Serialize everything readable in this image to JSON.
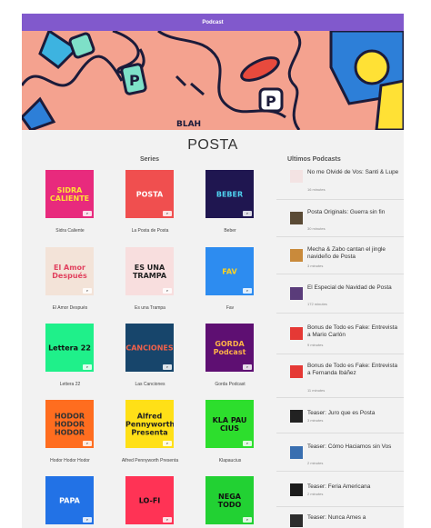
{
  "topbar": {
    "title": "Podcast"
  },
  "hero": {
    "doodle_text": "BLAH"
  },
  "page": {
    "title": "POSTA"
  },
  "sections": {
    "series": "Series",
    "latest": "Ultimos Podcasts"
  },
  "series": [
    {
      "name": "Sidra Caliente",
      "cover_text": "SIDRA CALIENTE",
      "bg": "#e82a7d",
      "fg": "#ffe135"
    },
    {
      "name": "La Posta de Posta",
      "cover_text": "POSTA",
      "bg": "#f04f4f",
      "fg": "#ffffff"
    },
    {
      "name": "Beber",
      "cover_text": "BEBER",
      "bg": "#1f1650",
      "fg": "#4fd3f0"
    },
    {
      "name": "El Amor Después",
      "cover_text": "El Amor Después",
      "bg": "#f3e3d8",
      "fg": "#e1425f"
    },
    {
      "name": "Es una Trampa",
      "cover_text": "ES UNA TRAMPA",
      "bg": "#f8dede",
      "fg": "#222222"
    },
    {
      "name": "Fav",
      "cover_text": "FAV",
      "bg": "#2d8cf0",
      "fg": "#ffd21f"
    },
    {
      "name": "Lettera 22",
      "cover_text": "Lettera 22",
      "bg": "#1ff08a",
      "fg": "#111111"
    },
    {
      "name": "Las Canciones",
      "cover_text": "CANCIONES",
      "bg": "#17456b",
      "fg": "#f2614a"
    },
    {
      "name": "Gorda Podcast",
      "cover_text": "GORDA Podcast",
      "bg": "#5e0f72",
      "fg": "#ffb347"
    },
    {
      "name": "Hodor Hodor Hodor",
      "cover_text": "HODOR HODOR HODOR",
      "bg": "#ff6d1f",
      "fg": "#333333"
    },
    {
      "name": "Alfred Pennyworth Presenta",
      "cover_text": "Alfred Pennyworth Presenta",
      "bg": "#ffe017",
      "fg": "#222222"
    },
    {
      "name": "Klapaucius",
      "cover_text": "KLA PAU CIUS",
      "bg": "#2dde2d",
      "fg": "#111111"
    },
    {
      "name": "",
      "cover_text": "PAPA",
      "bg": "#2272e6",
      "fg": "#ffffff"
    },
    {
      "name": "",
      "cover_text": "LO-FI",
      "bg": "#ff3355",
      "fg": "#111111"
    },
    {
      "name": "",
      "cover_text": "NEGA TODO",
      "bg": "#22d133",
      "fg": "#111111"
    }
  ],
  "podcasts": [
    {
      "title": "No me Olvidé de Vos: Santi & Lupe",
      "duration": "16 minutes",
      "thumb": "#f3e3e3"
    },
    {
      "title": "Posta Originals: Guerra sin fin",
      "duration": "30 minutes",
      "thumb": "#5a4a35"
    },
    {
      "title": "Mecha & Zabo cantan el jingle navideño de Posta",
      "duration": "3 minutes",
      "thumb": "#c98a3b"
    },
    {
      "title": "El Especial de Navidad de Posta",
      "duration": "172 minutes",
      "thumb": "#5a3c7a"
    },
    {
      "title": "Bonus de Todo es Fake: Entrevista a Mario Carlón",
      "duration": "9 minutes",
      "thumb": "#e53935"
    },
    {
      "title": "Bonus de Todo es Fake: Entrevista a Fernanda Ibáñez",
      "duration": "11 minutes",
      "thumb": "#e53935"
    },
    {
      "title": "Teaser: Juro que es Posta",
      "duration": "3 minutes",
      "thumb": "#222222"
    },
    {
      "title": "Teaser: Cómo Haciamos sin Vos",
      "duration": "2 minutes",
      "thumb": "#3a6fb0"
    },
    {
      "title": "Teaser: Feria Americana",
      "duration": "2 minutes",
      "thumb": "#1a1a1a"
    },
    {
      "title": "Teaser: Nunca Ames a",
      "duration": "",
      "thumb": "#2d2d2d"
    }
  ]
}
